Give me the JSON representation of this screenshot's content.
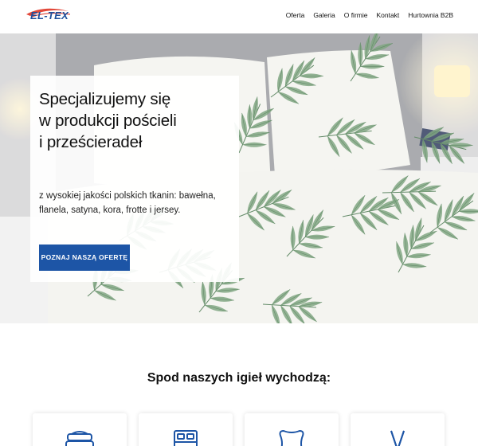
{
  "header": {
    "logo_text": "EL-TEX",
    "nav": [
      {
        "label": "Oferta"
      },
      {
        "label": "Galeria"
      },
      {
        "label": "O firmie"
      },
      {
        "label": "Kontakt"
      },
      {
        "label": "Hurtownia B2B"
      }
    ]
  },
  "hero": {
    "title_lines": [
      "Specjalizujemy się",
      "w produkcji pościeli",
      "i prześcieradeł"
    ],
    "subtitle": "z wysokiej jakości polskich tkanin: bawełna, flanela, satyna, kora, frotte i jersey.",
    "cta_label": "POZNAJ NASZĄ OFERTĘ"
  },
  "products": {
    "title": "Spod naszych igieł wychodzą:",
    "cards": [
      {
        "icon": "bedding-stack-icon"
      },
      {
        "icon": "bed-icon"
      },
      {
        "icon": "pillow-icon"
      },
      {
        "icon": "ribbon-icon"
      }
    ]
  },
  "colors": {
    "brand_blue": "#1d55a6",
    "logo_red": "#e2483a",
    "leaf_green": "#5f8f63"
  }
}
